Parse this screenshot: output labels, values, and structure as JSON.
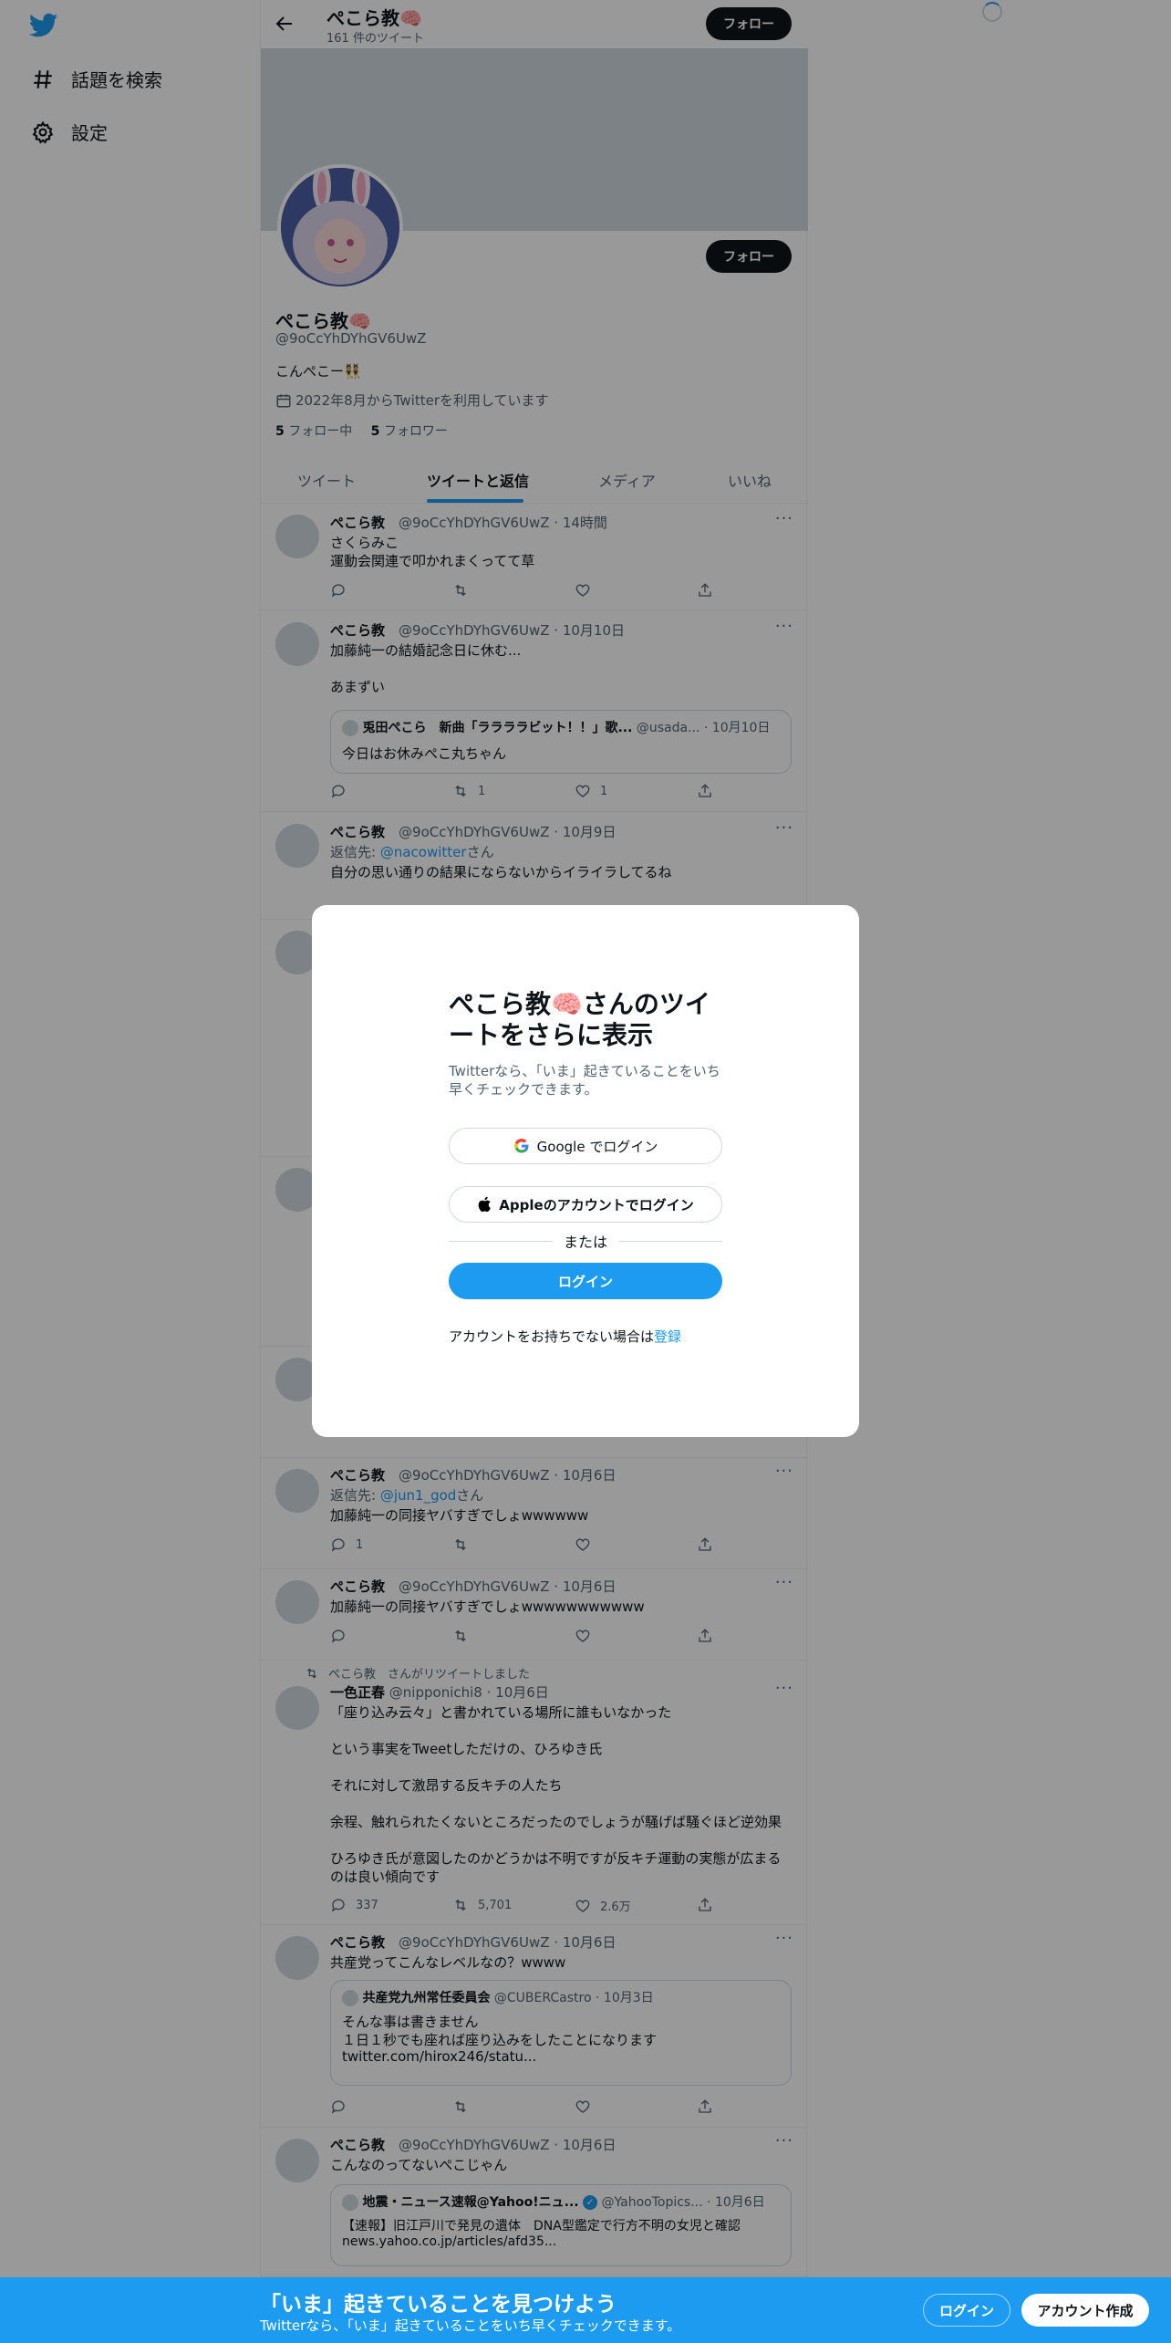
{
  "nav": {
    "explore_label": "話題を検索",
    "settings_label": "設定"
  },
  "header": {
    "name": "ぺこら教🧠",
    "tweet_count": "161 件のツイート",
    "follow_label": "フォロー"
  },
  "profile": {
    "name": "ぺこら教🧠",
    "handle": "@9oCcYhDYhGV6UwZ",
    "bio": "こんぺこー👯",
    "joined": "2022年8月からTwitterを利用しています",
    "following_count": "5",
    "following_label": "フォロー中",
    "followers_count": "5",
    "followers_label": "フォロワー",
    "follow_label": "フォロー"
  },
  "tabs": [
    "ツイート",
    "ツイートと返信",
    "メディア",
    "いいね"
  ],
  "tweets": [
    {
      "name": "ぺこら教",
      "handle": "@9oCcYhDYhGV6UwZ",
      "time": "· 14時間",
      "lines": [
        "さくらみこ",
        "運動会関連で叩かれまくってて草"
      ]
    },
    {
      "name": "ぺこら教",
      "handle": "@9oCcYhDYhGV6UwZ",
      "time": "· 10月10日",
      "lines": [
        "加藤純一の結婚記念日に休む...",
        "あまずい"
      ],
      "quote": {
        "name": "兎田ぺこら　新曲「ララララビット！！」歌...",
        "handle": "@usada...",
        "time": "· 10月10日",
        "text": "今日はお休みぺこ丸ちゃん"
      },
      "retweets": "1",
      "likes": "1"
    },
    {
      "name": "ぺこら教",
      "handle": "@9oCcYhDYhGV6UwZ",
      "time": "· 10月9日",
      "reply_prefix": "返信先:",
      "reply_to": "@nacowitter",
      "reply_suffix": "さん",
      "lines": [
        "自分の思い通りの結果にならないからイライラしてるね"
      ]
    },
    {
      "name": "ぺこら教",
      "handle": "@9oCcYhDYhGV6UwZ",
      "time": "· 10月6日",
      "reply_prefix": "返信先:",
      "reply_to": "@jun1_god",
      "reply_suffix": "さん",
      "lines": [
        "加藤純一の同接ヤバすぎでしょwwwwww"
      ],
      "replies": "1"
    },
    {
      "name": "ぺこら教",
      "handle": "@9oCcYhDYhGV6UwZ",
      "time": "· 10月6日",
      "lines": [
        "加藤純一の同接ヤバすぎでしょwwwwwwwwwww"
      ]
    },
    {
      "retweeted_by": "ぺこら教　さんがリツイートしました",
      "name": "一色正春",
      "handle": "@nipponichi8",
      "time": "· 10月6日",
      "lines": [
        "「座り込み云々」と書かれている場所に誰もいなかった",
        "という事実をTweetしただけの、ひろゆき氏",
        "それに対して激昂する反キチの人たち",
        "余程、触れられたくないところだったのでしょうが騒げば騒ぐほど逆効果",
        "ひろゆき氏が意図したのかどうかは不明ですが反キチ運動の実態が広まる",
        "のは良い傾向です"
      ],
      "replies": "337",
      "retweets": "5,701",
      "likes": "2.6万"
    },
    {
      "name": "ぺこら教",
      "handle": "@9oCcYhDYhGV6UwZ",
      "time": "· 10月6日",
      "lines": [
        "共産党ってこんなレベルなの？wwww"
      ],
      "quote": {
        "name": "共産党九州常任委員会",
        "handle": "@CUBERCastro",
        "time": "· 10月3日",
        "text": "そんな事は書きません",
        "text2": "１日１秒でも座れば座り込みをしたことになります",
        "text3": "twitter.com/hirox246/statu..."
      }
    },
    {
      "name": "ぺこら教",
      "handle": "@9oCcYhDYhGV6UwZ",
      "time": "· 10月6日",
      "lines": [
        "こんなのってないぺこじゃん"
      ],
      "quote": {
        "name": "地震・ニュース速報@Yahoo!ニュ...",
        "handle": "@YahooTopics...",
        "time": "· 10月6日",
        "text": "【速報】旧江戸川で発見の遺体　DNA型鑑定で行方不明の女児と確認",
        "text2": "news.yahoo.co.jp/articles/afd35..."
      }
    }
  ],
  "modal": {
    "title": "ぺこら教🧠さんのツイートをさらに表示",
    "subtitle": "Twitterなら、「いま」起きていることをいち早くチェックできます。",
    "google_label": "Google でログイン",
    "apple_label": "Appleのアカウントでログイン",
    "or_label": "または",
    "login_label": "ログイン",
    "signup_prompt": "アカウントをお持ちでない場合は",
    "signup_link": "登録"
  },
  "bottom_bar": {
    "title": "「いま」起きていることを見つけよう",
    "subtitle": "Twitterなら、「いま」起きていることをいち早くチェックできます。",
    "login_label": "ログイン",
    "signup_label": "アカウント作成"
  },
  "colors": {
    "accent": "#1d9bf0",
    "text": "#0f1419",
    "muted": "#536471"
  }
}
